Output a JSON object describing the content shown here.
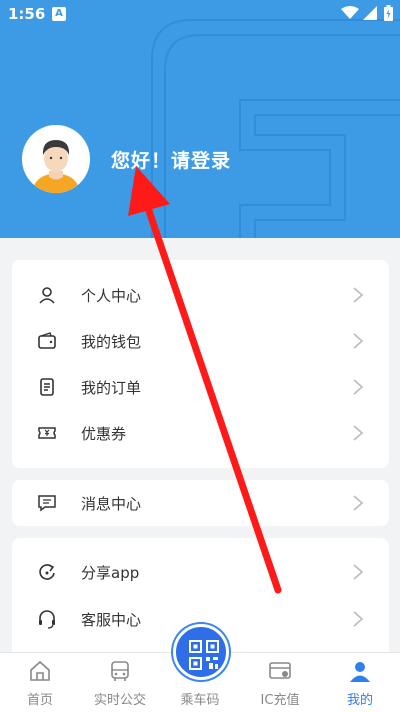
{
  "status": {
    "time": "1:56",
    "badge": "A"
  },
  "profile": {
    "greeting": "您好！请登录"
  },
  "menu_group1": [
    {
      "label": "个人中心",
      "icon": "person-icon"
    },
    {
      "label": "我的钱包",
      "icon": "wallet-icon"
    },
    {
      "label": "我的订单",
      "icon": "order-icon"
    },
    {
      "label": "优惠券",
      "icon": "coupon-icon"
    }
  ],
  "menu_group2": [
    {
      "label": "消息中心",
      "icon": "message-icon"
    }
  ],
  "menu_group3": [
    {
      "label": "分享app",
      "icon": "share-icon"
    },
    {
      "label": "客服中心",
      "icon": "headset-icon"
    }
  ],
  "nav": [
    {
      "label": "首页",
      "icon": "home-icon",
      "active": false
    },
    {
      "label": "实时公交",
      "icon": "bus-icon",
      "active": false
    },
    {
      "label": "乘车码",
      "icon": "qr-code-icon",
      "active": false
    },
    {
      "label": "IC充值",
      "icon": "card-recharge-icon",
      "active": false
    },
    {
      "label": "我的",
      "icon": "user-icon",
      "active": true
    }
  ],
  "colors": {
    "header": "#3d9be6",
    "accent": "#2f80ed",
    "annotation_arrow": "#ff1a1a"
  }
}
